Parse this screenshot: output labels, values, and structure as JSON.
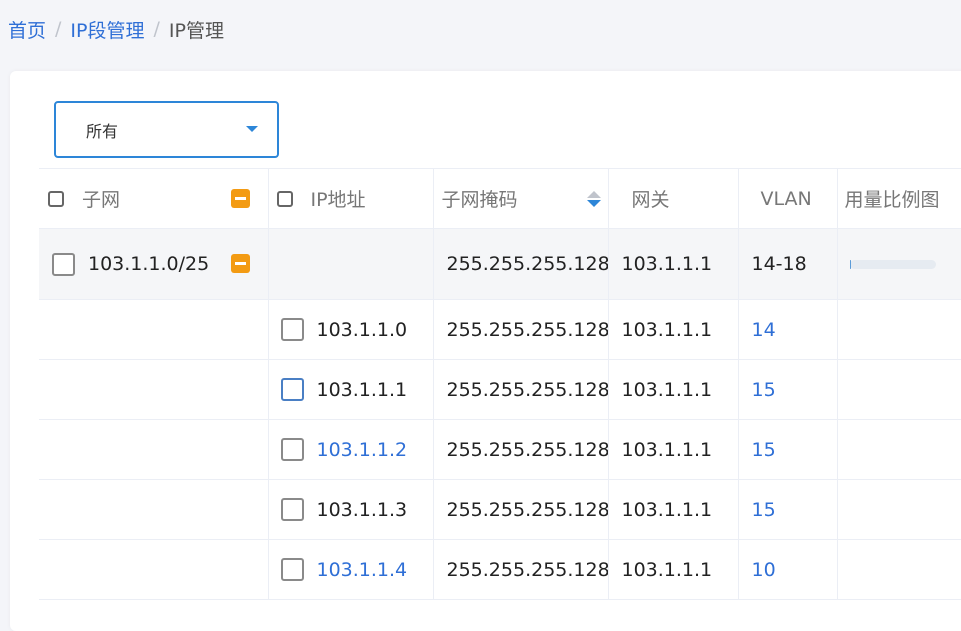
{
  "breadcrumb": {
    "home": "首页",
    "section": "IP段管理",
    "current": "IP管理",
    "separator": "/"
  },
  "filter": {
    "selected": "所有"
  },
  "table": {
    "columns": {
      "subnet": "子网",
      "ip": "IP地址",
      "mask": "子网掩码",
      "gateway": "网关",
      "vlan": "VLAN",
      "usage": "用量比例图"
    },
    "subnet_row": {
      "subnet": "103.1.1.0/25",
      "mask": "255.255.255.128",
      "gateway": "103.1.1.1",
      "vlan": "14-18",
      "usage_fraction": 0.02
    },
    "ip_rows": [
      {
        "ip": "103.1.1.0",
        "ip_is_link": false,
        "mask": "255.255.255.128",
        "gateway": "103.1.1.1",
        "vlan": "14"
      },
      {
        "ip": "103.1.1.1",
        "ip_is_link": false,
        "mask": "255.255.255.128",
        "gateway": "103.1.1.1",
        "vlan": "15"
      },
      {
        "ip": "103.1.1.2",
        "ip_is_link": true,
        "mask": "255.255.255.128",
        "gateway": "103.1.1.1",
        "vlan": "15"
      },
      {
        "ip": "103.1.1.3",
        "ip_is_link": false,
        "mask": "255.255.255.128",
        "gateway": "103.1.1.1",
        "vlan": "15"
      },
      {
        "ip": "103.1.1.4",
        "ip_is_link": true,
        "mask": "255.255.255.128",
        "gateway": "103.1.1.1",
        "vlan": "10"
      }
    ]
  },
  "colors": {
    "accent": "#2d86d8",
    "link": "#2f6fd6",
    "collapse": "#f39b13"
  }
}
